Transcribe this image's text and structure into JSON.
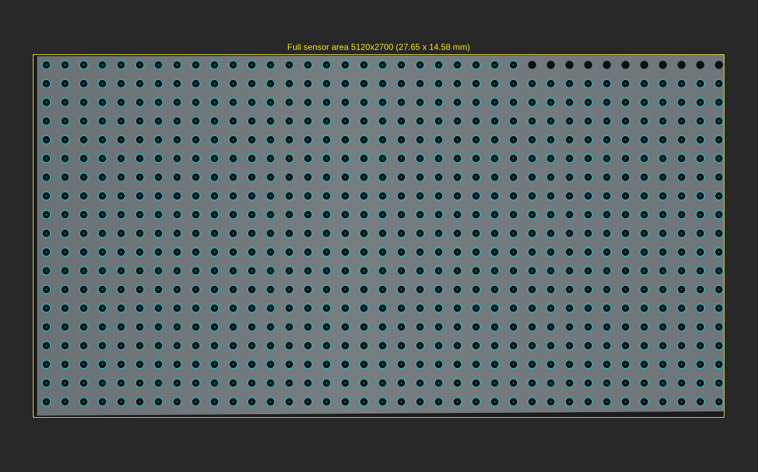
{
  "sensor": {
    "label": "Full sensor area 5120x2700 (27.65 x 14.58 mm)",
    "outline_color": "#d8d23a",
    "label_color": "#f2e600"
  },
  "target": {
    "type": "circle-grid-calibration-target",
    "rows": 19,
    "cols": 38,
    "plate_color": "#727a7d",
    "dot_color": "#0c0e10",
    "detection_color": "#14c8d0",
    "center_mark_color": "#14c8d0",
    "top_row_detected_cols": 26,
    "undetected_right_cols": 1
  }
}
